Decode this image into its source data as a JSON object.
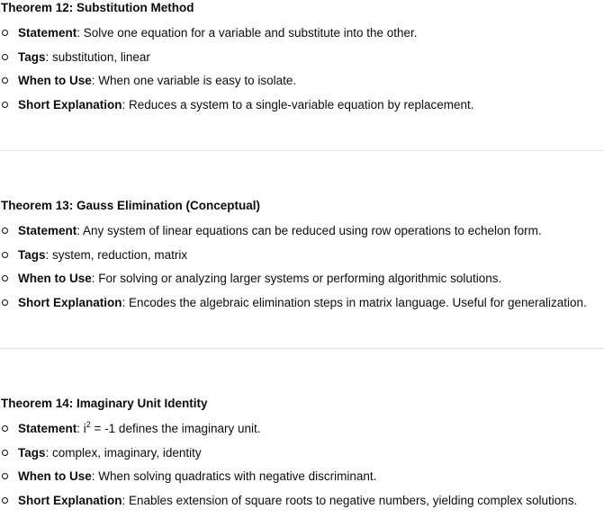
{
  "sections": [
    {
      "title": "Theorem 12: Substitution Method",
      "items": [
        {
          "key": "Statement",
          "sep": ": ",
          "text": "Solve one equation for a variable and substitute into the other."
        },
        {
          "key": "Tags",
          "sep": ": ",
          "text": "substitution, linear"
        },
        {
          "key": "When to Use",
          "sep": ": ",
          "text": "When one variable is easy to isolate."
        },
        {
          "key": "Short Explanation",
          "sep": ": ",
          "text": "Reduces a system to a single-variable equation by replacement."
        }
      ]
    },
    {
      "title": "Theorem 13: Gauss Elimination (Conceptual)",
      "items": [
        {
          "key": "Statement",
          "sep": ": ",
          "text": "Any system of linear equations can be reduced using row operations to echelon form."
        },
        {
          "key": "Tags",
          "sep": ": ",
          "text": "system, reduction, matrix"
        },
        {
          "key": "When to Use",
          "sep": ": ",
          "text": "For solving or analyzing larger systems or performing algorithmic solutions."
        },
        {
          "key": "Short Explanation",
          "sep": ": ",
          "text": "Encodes the algebraic elimination steps in matrix language. Useful for generalization."
        }
      ]
    },
    {
      "title": "Theorem 14: Imaginary Unit Identity",
      "items": [
        {
          "key": "Statement",
          "sep": ": ",
          "pre": "i",
          "sup": "2",
          "text": " = -1 defines the imaginary unit."
        },
        {
          "key": "Tags",
          "sep": ": ",
          "text": "complex, imaginary, identity"
        },
        {
          "key": "When to Use",
          "sep": ": ",
          "text": "When solving quadratics with negative discriminant."
        },
        {
          "key": "Short Explanation",
          "sep": ": ",
          "text": "Enables extension of square roots to negative numbers, yielding complex solutions."
        }
      ]
    }
  ]
}
